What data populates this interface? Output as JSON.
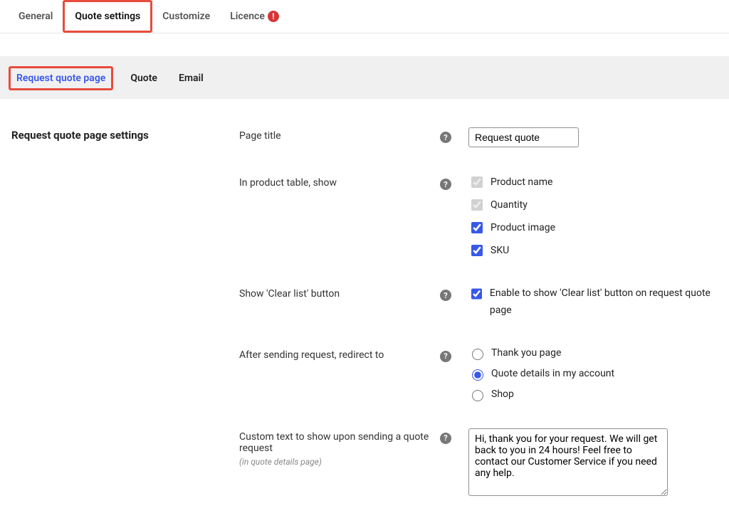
{
  "topTabs": {
    "general": "General",
    "quoteSettings": "Quote settings",
    "customize": "Customize",
    "licence": "Licence"
  },
  "subTabs": {
    "requestQuotePage": "Request quote page",
    "quote": "Quote",
    "email": "Email"
  },
  "section": {
    "title": "Request quote page settings"
  },
  "fields": {
    "pageTitle": {
      "label": "Page title",
      "value": "Request quote"
    },
    "productTable": {
      "label": "In product table, show",
      "options": {
        "productName": "Product name",
        "quantity": "Quantity",
        "productImage": "Product image",
        "sku": "SKU"
      }
    },
    "clearList": {
      "label": "Show 'Clear list' button",
      "checkLabel": "Enable to show 'Clear list' button on request quote page"
    },
    "redirect": {
      "label": "After sending request, redirect to",
      "options": {
        "thankYou": "Thank you page",
        "quoteDetails": "Quote details in my account",
        "shop": "Shop"
      }
    },
    "customText": {
      "label": "Custom text to show upon sending a quote request",
      "note": "(in quote details page)",
      "value": "Hi, thank you for your request. We will get back to you in 24 hours! Feel free to contact our Customer Service if you need any help."
    }
  }
}
